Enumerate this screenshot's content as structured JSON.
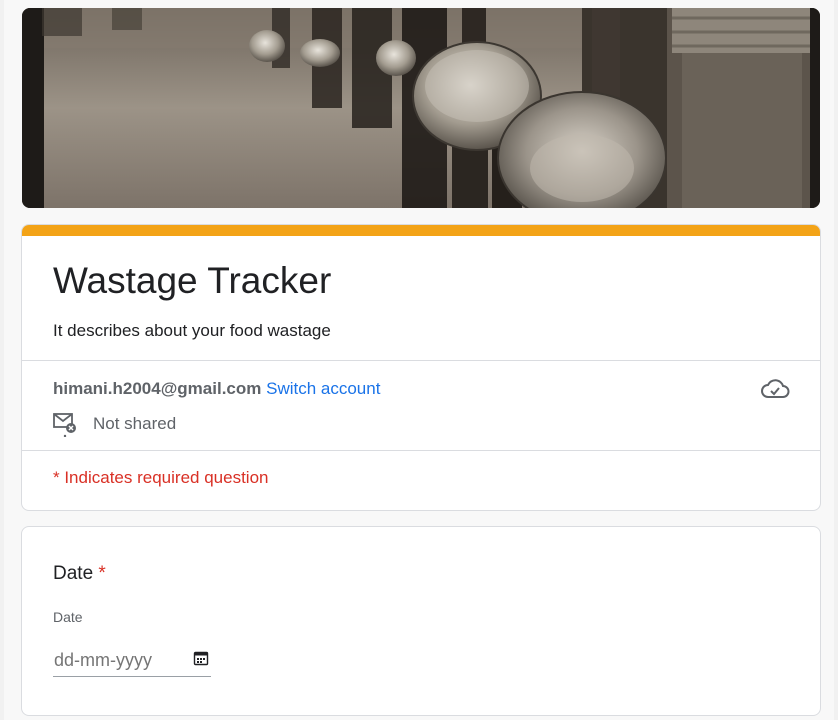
{
  "header": {
    "image_alt": "People holding empty metal bowls"
  },
  "form": {
    "title": "Wastage Tracker",
    "description": "It describes about your food wastage",
    "accent_color": "#f3a317"
  },
  "account": {
    "email": "himani.h2004@gmail.com",
    "switch_label": "Switch account",
    "not_shared_label": "Not shared",
    "cloud_icon": "cloud-check-icon",
    "mail_icon": "mail-not-shared-icon"
  },
  "required_note": "* Indicates required question",
  "question": {
    "title": "Date",
    "required_marker": "*",
    "sublabel": "Date",
    "input_placeholder": "dd-mm-yyyy",
    "calendar_icon": "calendar-icon"
  }
}
